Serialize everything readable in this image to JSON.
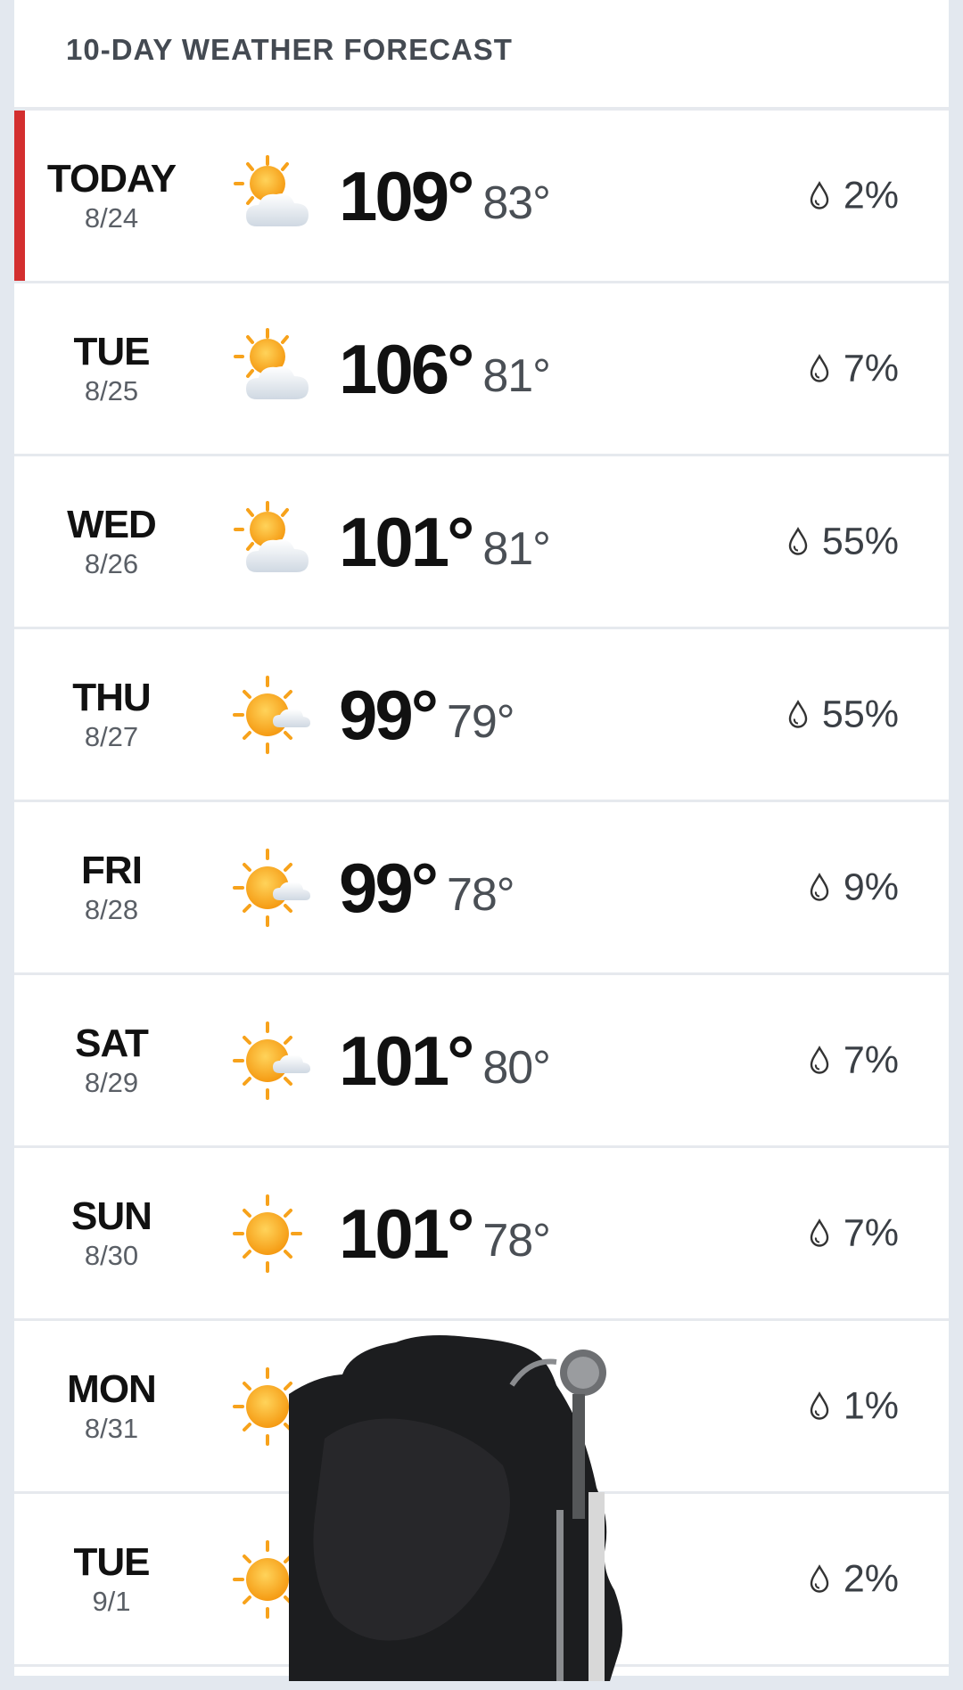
{
  "header": {
    "title": "10-DAY WEATHER FORECAST"
  },
  "colors": {
    "today_accent": "#d32f2f",
    "sun": "#f7a21b",
    "cloud": "#e8edf2"
  },
  "days": [
    {
      "day": "TODAY",
      "date": "8/24",
      "icon": "partly-cloudy-icon",
      "high": "109°",
      "low": "83°",
      "precip": "2%"
    },
    {
      "day": "TUE",
      "date": "8/25",
      "icon": "partly-cloudy-icon",
      "high": "106°",
      "low": "81°",
      "precip": "7%"
    },
    {
      "day": "WED",
      "date": "8/26",
      "icon": "partly-cloudy-icon",
      "high": "101°",
      "low": "81°",
      "precip": "55%"
    },
    {
      "day": "THU",
      "date": "8/27",
      "icon": "mostly-sunny-icon",
      "high": "99°",
      "low": "79°",
      "precip": "55%"
    },
    {
      "day": "FRI",
      "date": "8/28",
      "icon": "mostly-sunny-icon",
      "high": "99°",
      "low": "78°",
      "precip": "9%"
    },
    {
      "day": "SAT",
      "date": "8/29",
      "icon": "mostly-sunny-icon",
      "high": "101°",
      "low": "80°",
      "precip": "7%"
    },
    {
      "day": "SUN",
      "date": "8/30",
      "icon": "sunny-icon",
      "high": "101°",
      "low": "78°",
      "precip": "7%"
    },
    {
      "day": "MON",
      "date": "8/31",
      "icon": "sunny-icon",
      "high": "",
      "low": "",
      "precip": "1%"
    },
    {
      "day": "TUE",
      "date": "9/1",
      "icon": "sunny-icon",
      "high": "",
      "low": "",
      "precip": "2%"
    }
  ]
}
